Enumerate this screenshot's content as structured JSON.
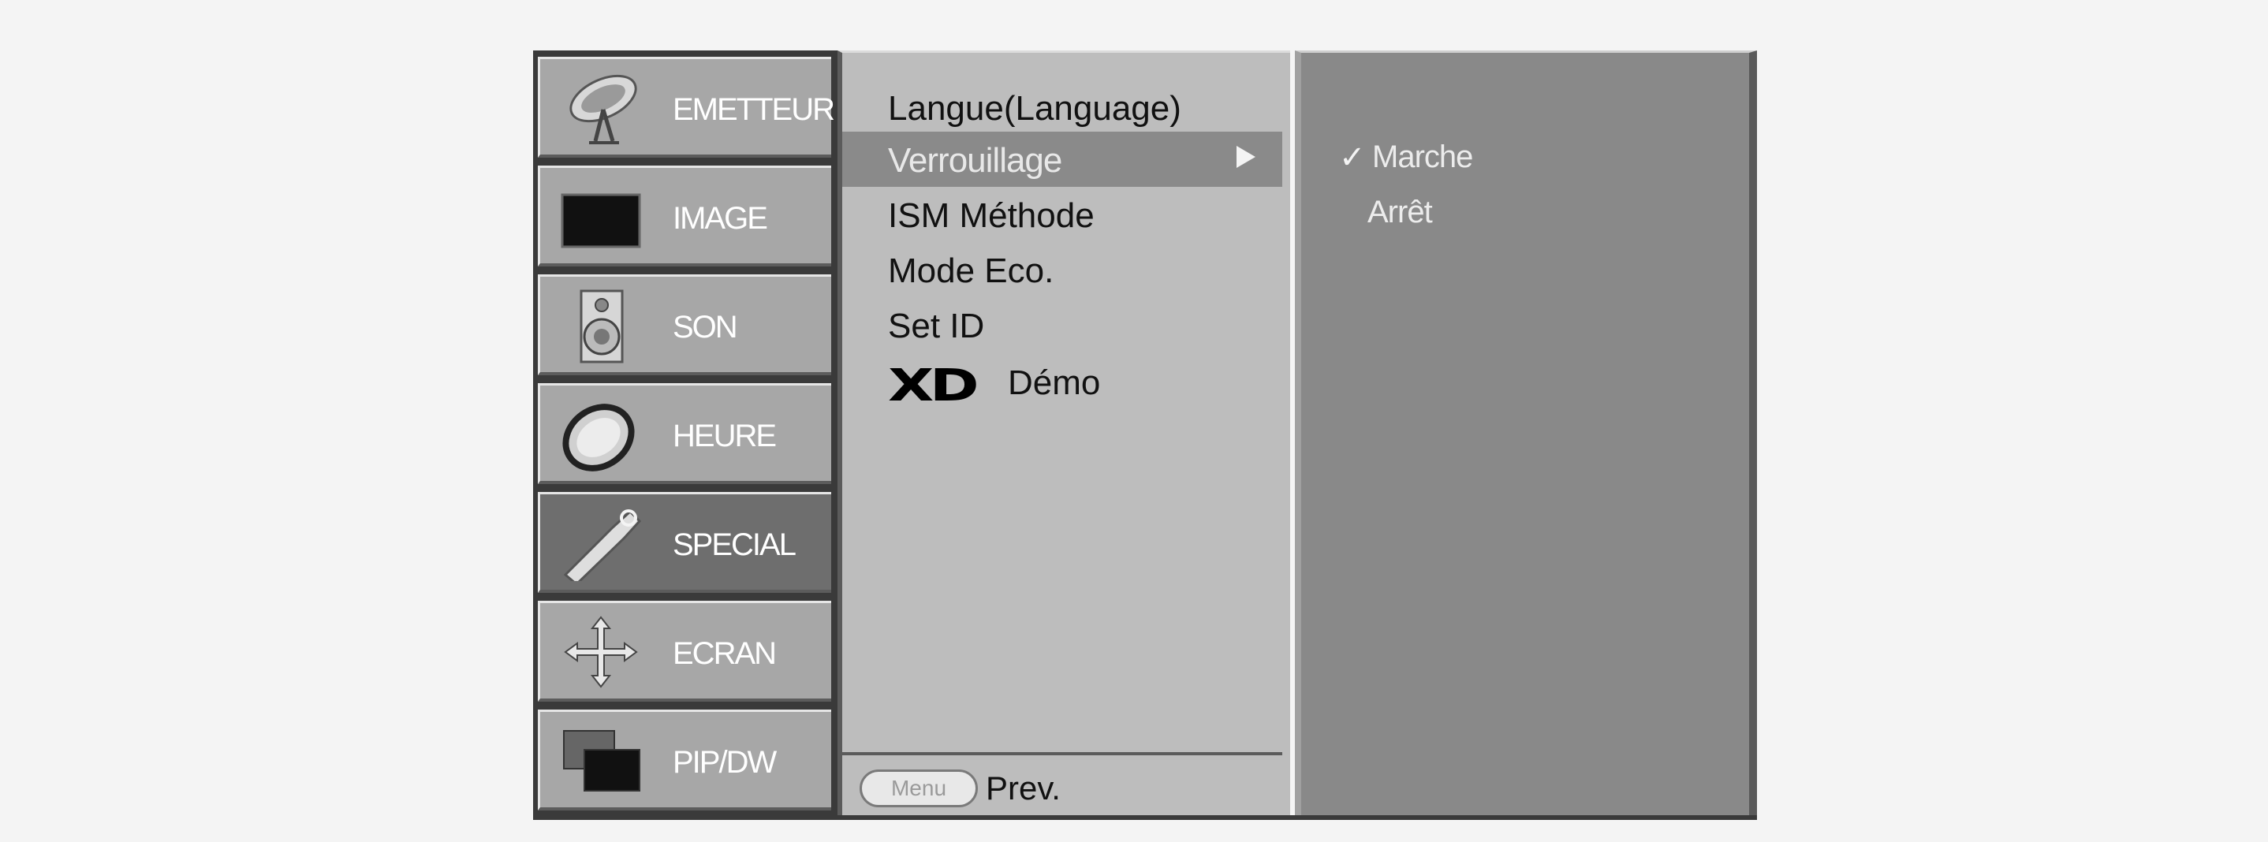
{
  "main_menu": {
    "items": [
      {
        "label": "EMETTEUR",
        "icon": "satellite-dish-icon",
        "active": false
      },
      {
        "label": "IMAGE",
        "icon": "tv-screen-icon",
        "active": false
      },
      {
        "label": "SON",
        "icon": "speaker-icon",
        "active": false
      },
      {
        "label": "HEURE",
        "icon": "clock-icon",
        "active": false
      },
      {
        "label": "SPECIAL",
        "icon": "tag-icon",
        "active": true
      },
      {
        "label": "ECRAN",
        "icon": "move-arrows-icon",
        "active": false
      },
      {
        "label": "PIP/DW",
        "icon": "pip-windows-icon",
        "active": false
      }
    ]
  },
  "sub_menu": {
    "items": [
      {
        "label": "Langue(Language)",
        "selected": false
      },
      {
        "label": "Verrouillage",
        "selected": true
      },
      {
        "label": "ISM Méthode",
        "selected": false
      },
      {
        "label": "Mode Eco.",
        "selected": false
      },
      {
        "label": "Set ID",
        "selected": false
      },
      {
        "logo": "XD",
        "label": "Démo",
        "selected": false
      }
    ],
    "footer": {
      "button_label": "Menu",
      "action_label": "Prev."
    }
  },
  "options": {
    "items": [
      {
        "label": "Marche",
        "checked": true
      },
      {
        "label": "Arrêt",
        "checked": false
      }
    ],
    "check_glyph": "✓"
  },
  "colors": {
    "background": "#f4f4f4",
    "menu_frame": "#3a3a3a",
    "menu_item": "#a7a7a7",
    "menu_item_active": "#6e6e6e",
    "sub_menu_bg": "#bdbdbd",
    "selected_row": "#8a8a8a",
    "option_panel_bg": "#898989"
  }
}
